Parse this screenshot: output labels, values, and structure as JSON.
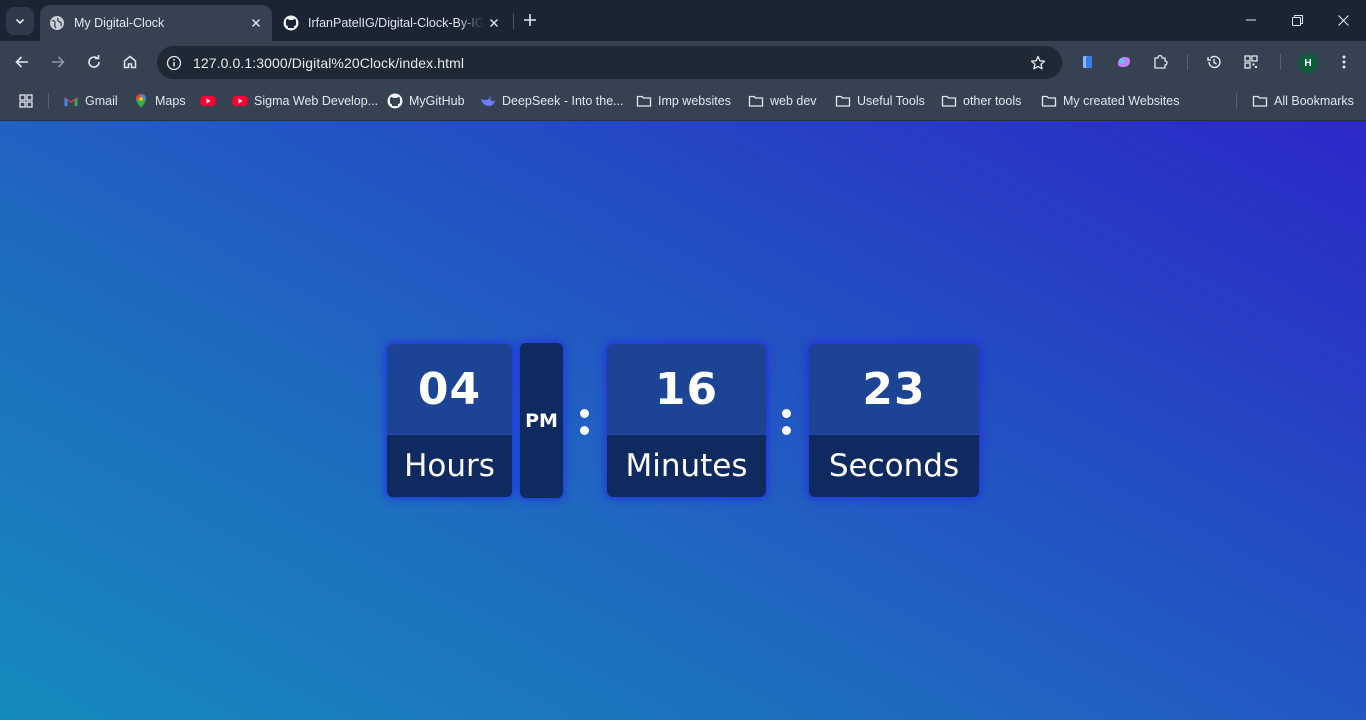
{
  "browser": {
    "tabs": [
      {
        "title": "My Digital-Clock",
        "active": true,
        "icon": "globe-icon"
      },
      {
        "title": "IrfanPatelIG/Digital-Clock-By-IG",
        "active": false,
        "icon": "github-icon"
      }
    ],
    "address": "127.0.0.1:3000/Digital%20Clock/index.html",
    "profile_initial": "H",
    "bookmarks": [
      {
        "label": "Gmail",
        "icon": "gmail-icon"
      },
      {
        "label": "Maps",
        "icon": "maps-icon"
      },
      {
        "label": "",
        "icon": "youtube-icon"
      },
      {
        "label": "Sigma Web Develop...",
        "icon": "youtube-icon"
      },
      {
        "label": "MyGitHub",
        "icon": "github-icon"
      },
      {
        "label": "DeepSeek - Into the...",
        "icon": "deepseek-icon"
      },
      {
        "label": "Imp websites",
        "icon": "folder-icon"
      },
      {
        "label": "web dev",
        "icon": "folder-icon"
      },
      {
        "label": "Useful Tools",
        "icon": "folder-icon"
      },
      {
        "label": "other tools",
        "icon": "folder-icon"
      },
      {
        "label": "My created Websites",
        "icon": "folder-icon"
      }
    ],
    "all_bookmarks": "All Bookmarks"
  },
  "clock": {
    "hours": {
      "value": "04",
      "label": "Hours"
    },
    "ampm": "PM",
    "minutes": {
      "value": "16",
      "label": "Minutes"
    },
    "seconds": {
      "value": "23",
      "label": "Seconds"
    }
  },
  "colors": {
    "chrome_dark": "#1b2433",
    "chrome": "#364152",
    "card_top": "#1d4494",
    "card_bottom": "#0e2a5e",
    "glow": "#2428eb",
    "bg_start": "#158bbc",
    "bg_end": "#2c28c7"
  }
}
